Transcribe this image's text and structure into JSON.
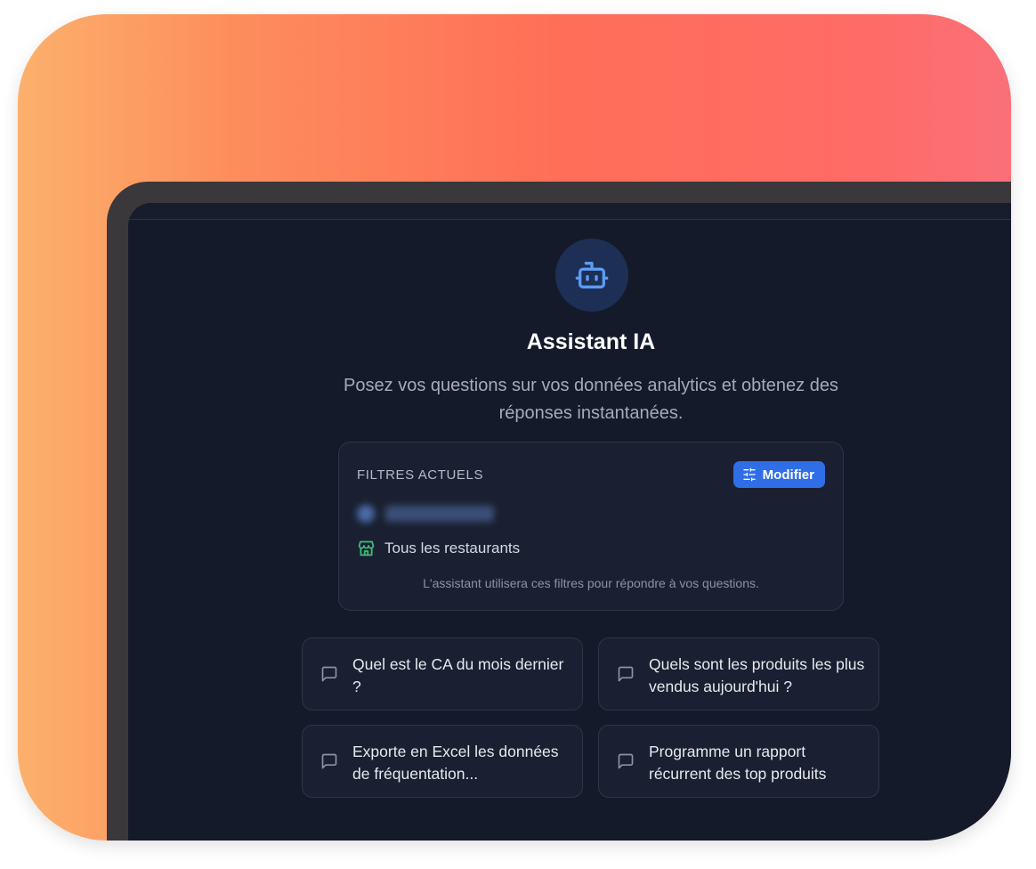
{
  "header": {
    "title": "Assistant IA",
    "subtitle": "Posez vos questions sur vos données analytics et obtenez des réponses instantanées."
  },
  "filters": {
    "title": "FILTRES ACTUELS",
    "modify_label": "Modifier",
    "blurred_value": "La Knocklaterie",
    "restaurant_label": "Tous les restaurants",
    "note": "L'assistant utilisera ces filtres pour répondre à vos questions."
  },
  "suggestions": [
    {
      "label": "Quel est le CA du mois dernier ?"
    },
    {
      "label": "Quels sont les produits les plus vendus aujourd'hui ?"
    },
    {
      "label": "Exporte en Excel les données de fréquentation..."
    },
    {
      "label": "Programme un rapport récurrent des top produits"
    }
  ],
  "colors": {
    "accent": "#2f6ee6",
    "bot_icon": "#5b9cf5",
    "store_icon": "#3fbf7a",
    "background": "#141a2a"
  },
  "icons": {
    "assistant": "bot-icon",
    "modify": "sliders-icon",
    "restaurant": "store-icon",
    "suggestion": "chat-bubble-icon"
  }
}
